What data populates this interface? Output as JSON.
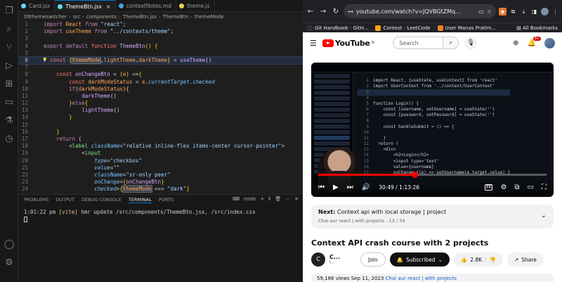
{
  "vscode": {
    "tabs": [
      {
        "label": "Card.jsx",
        "color": "#61dafb",
        "active": false
      },
      {
        "label": "ThemeBtn.jsx",
        "color": "#61dafb",
        "active": true
      },
      {
        "label": "contextNotes.md",
        "color": "#4aa3df",
        "active": false
      },
      {
        "label": "theme.js",
        "color": "#e8d44d",
        "active": false
      }
    ],
    "breadcrumb": [
      "09themeswitcher",
      "src",
      "components",
      "ThemeBtn.jsx",
      "ThemeBtn",
      "themeMode"
    ],
    "panel_tabs": [
      "PROBLEMS",
      "OUTPUT",
      "DEBUG CONSOLE",
      "TERMINAL",
      "PORTS"
    ],
    "active_panel_tab": "TERMINAL",
    "terminal_shell": "node",
    "terminal_time": "1:01:22 pm",
    "terminal_tag": "[vite]",
    "terminal_msg": "hmr update /src/components/ThemeBtn.jsx, /src/index.css",
    "line_numbers": [
      "1",
      "2",
      "3",
      "4",
      "5",
      "6",
      "7",
      "8",
      "9",
      "10",
      "11",
      "12",
      "13",
      "14",
      "15",
      "16",
      "17",
      "18",
      "19",
      "20",
      "21",
      "22",
      "23",
      "24"
    ]
  },
  "browser": {
    "url": "youtube.com/watch?v=JQVBGtZMq...",
    "bookmarks": [
      {
        "label": "Git Handbook · GitH...",
        "color": "#333333"
      },
      {
        "label": "Contest - LeetCode",
        "color": "#ffa116"
      },
      {
        "label": "User Manas Pratim...",
        "color": "#f48024"
      }
    ],
    "all_bookmarks": "All Bookmarks"
  },
  "youtube": {
    "logo_text": "YouTube",
    "logo_region": "IN",
    "search_placeholder": "Search",
    "notif_count": "9+",
    "time_current": "30:49",
    "time_total": "1:13:26",
    "time_sep": " / ",
    "progress_fraction": 0.42,
    "next_label": "Next:",
    "next_title": "Context api with local storage | project",
    "next_sub": "Chai aur react | with projects - 13 / 34",
    "video_title": "Context API crash course with 2 projects",
    "channel_initial": "C",
    "channel_name": "C...",
    "channel_subs": "I...",
    "join_label": "Join",
    "subscribed_label": "Subscribed",
    "likes": "2.8K",
    "share_label": "Share",
    "views_text": "59,186 views  Sep 11, 2023",
    "views_link": "Chai aur react | with projects"
  }
}
